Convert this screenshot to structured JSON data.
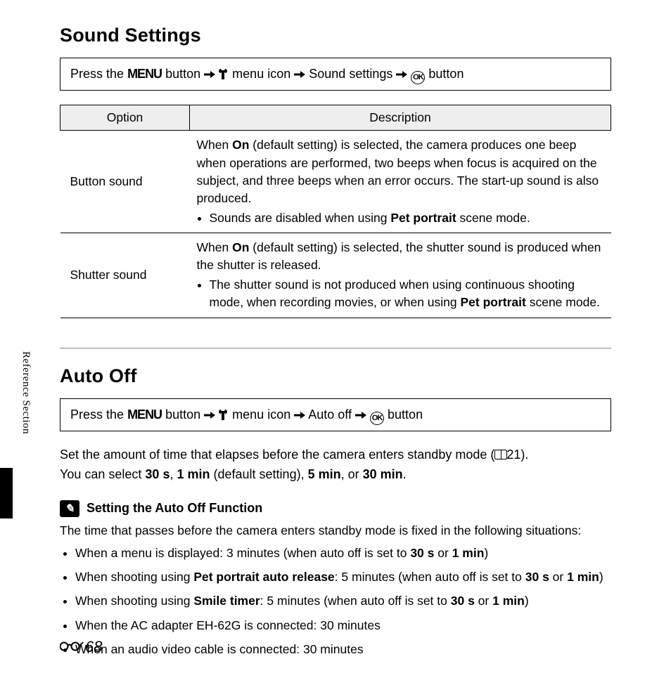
{
  "sidebar_label": "Reference Section",
  "page_number": "68",
  "section1": {
    "title": "Sound Settings",
    "nav": {
      "prefix": "Press the",
      "menu_word": "MENU",
      "after_menu": "button",
      "step2": "menu icon",
      "step3": "Sound settings",
      "final": "button"
    },
    "table": {
      "head_option": "Option",
      "head_desc": "Description",
      "rows": [
        {
          "name": "Button sound",
          "desc_main_pre": "When ",
          "desc_bold1": "On",
          "desc_main_post": " (default setting) is selected, the camera produces one beep when operations are performed, two beeps when focus is acquired on the subject, and three beeps when an error occurs. The start-up sound is also produced.",
          "bullet_pre": "Sounds are disabled when using ",
          "bullet_bold": "Pet portrait",
          "bullet_post": " scene mode."
        },
        {
          "name": "Shutter sound",
          "desc_main_pre": "When ",
          "desc_bold1": "On",
          "desc_main_post": " (default setting) is selected, the shutter sound is produced when the shutter is released.",
          "bullet_pre": "The shutter sound is not produced when using continuous shooting mode, when recording movies, or when using ",
          "bullet_bold": "Pet portrait",
          "bullet_post": " scene mode."
        }
      ]
    }
  },
  "section2": {
    "title": "Auto Off",
    "nav": {
      "prefix": "Press the",
      "menu_word": "MENU",
      "after_menu": "button",
      "step2": "menu icon",
      "step3": "Auto off",
      "final": "button"
    },
    "intro_line1_pre": "Set the amount of time that elapses before the camera enters standby mode (",
    "intro_line1_ref": "21",
    "intro_line1_post": ").",
    "intro_line2_pre": "You can select ",
    "opt1": "30 s",
    "sep1": ", ",
    "opt2": "1 min",
    "opt2_post": " (default setting), ",
    "opt3": "5 min",
    "sep3": ", or ",
    "opt4": "30 min",
    "intro_line2_post": ".",
    "note": {
      "title": "Setting the Auto Off Function",
      "lead": "The time that passes before the camera enters standby mode is fixed in the following situations:",
      "items": [
        {
          "pre": "When a menu is displayed: 3 minutes (when auto off is set to ",
          "b1": "30 s",
          "mid": " or ",
          "b2": "1 min",
          "post": ")"
        },
        {
          "pre": "When shooting using ",
          "b0": "Pet portrait auto release",
          "mid0": ": 5 minutes (when auto off is set to ",
          "b1": "30 s",
          "mid": " or ",
          "b2": "1 min",
          "post": ")"
        },
        {
          "pre": "When shooting using ",
          "b0": "Smile timer",
          "mid0": ": 5 minutes (when auto off is set to ",
          "b1": "30 s",
          "mid": " or ",
          "b2": "1 min",
          "post": ")"
        },
        {
          "plain": "When the AC adapter EH-62G is connected: 30 minutes"
        },
        {
          "plain": "When an audio video cable is connected: 30 minutes"
        }
      ]
    }
  }
}
